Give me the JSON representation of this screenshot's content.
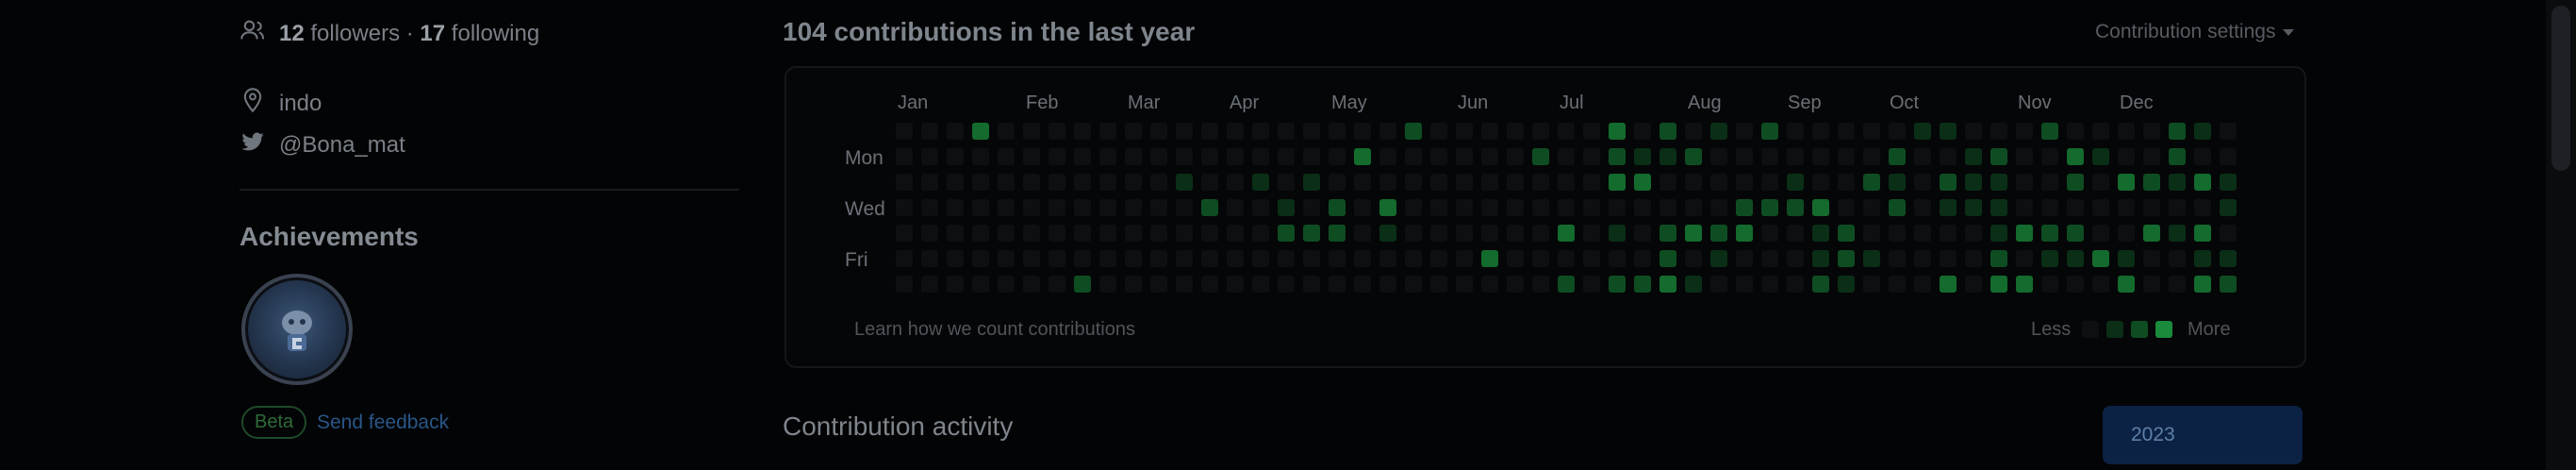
{
  "profile": {
    "followers_count": "12",
    "followers_label": "followers",
    "separator": "·",
    "following_count": "17",
    "following_label": "following",
    "location": "indo",
    "twitter": "@Bona_mat"
  },
  "achievements": {
    "title": "Achievements",
    "beta_label": "Beta",
    "feedback_label": "Send feedback"
  },
  "contributions": {
    "title": "104 contributions in the last year",
    "settings_label": "Contribution settings",
    "months": [
      "Jan",
      "Feb",
      "Mar",
      "Apr",
      "May",
      "Jun",
      "Jul",
      "Aug",
      "Sep",
      "Oct",
      "Nov",
      "Dec"
    ],
    "days": [
      "Mon",
      "Wed",
      "Fri"
    ],
    "learn_label": "Learn how we count contributions",
    "legend_less": "Less",
    "legend_more": "More",
    "colors": [
      "#0d0f11",
      "#0b2e17",
      "#0e4d22",
      "#136b2e",
      "#1a8a3c"
    ]
  },
  "activity": {
    "title": "Contribution activity",
    "year": "2023"
  }
}
